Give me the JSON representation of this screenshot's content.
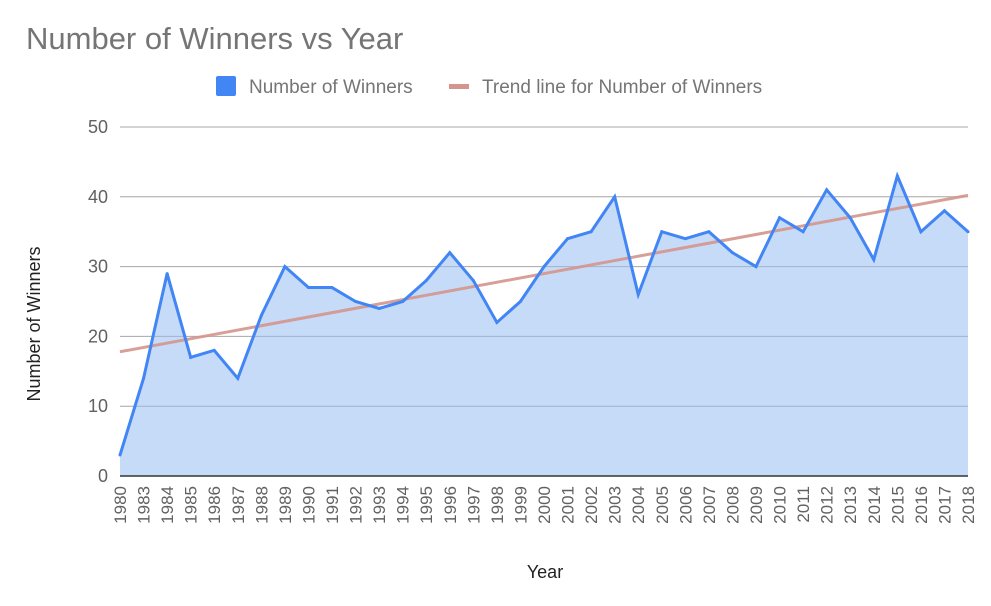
{
  "chart_data": {
    "type": "area",
    "title": "Number of Winners vs Year",
    "xlabel": "Year",
    "ylabel": "Number of Winners",
    "ylim": [
      0,
      50
    ],
    "yticks": [
      0,
      10,
      20,
      30,
      40,
      50
    ],
    "grid": true,
    "legend_position": "top",
    "categories": [
      "1980",
      "1983",
      "1984",
      "1985",
      "1986",
      "1987",
      "1988",
      "1989",
      "1990",
      "1991",
      "1992",
      "1993",
      "1994",
      "1995",
      "1996",
      "1997",
      "1998",
      "1999",
      "2000",
      "2001",
      "2002",
      "2003",
      "2004",
      "2005",
      "2006",
      "2007",
      "2008",
      "2009",
      "2010",
      "2011",
      "2012",
      "2013",
      "2014",
      "2015",
      "2016",
      "2017",
      "2018"
    ],
    "series": [
      {
        "name": "Number of Winners",
        "color": "#4285f4",
        "fill": "#c6dbf8",
        "values": [
          3,
          14,
          29,
          17,
          18,
          14,
          23,
          30,
          27,
          27,
          25,
          24,
          25,
          28,
          32,
          28,
          22,
          25,
          30,
          34,
          35,
          40,
          26,
          35,
          34,
          35,
          32,
          30,
          37,
          35,
          41,
          37,
          31,
          43,
          35,
          38,
          35
        ]
      },
      {
        "name": "Trend line for Number of Winners",
        "type": "trendline",
        "color": "#d4958c",
        "start": 17.8,
        "end": 40.2
      }
    ]
  }
}
